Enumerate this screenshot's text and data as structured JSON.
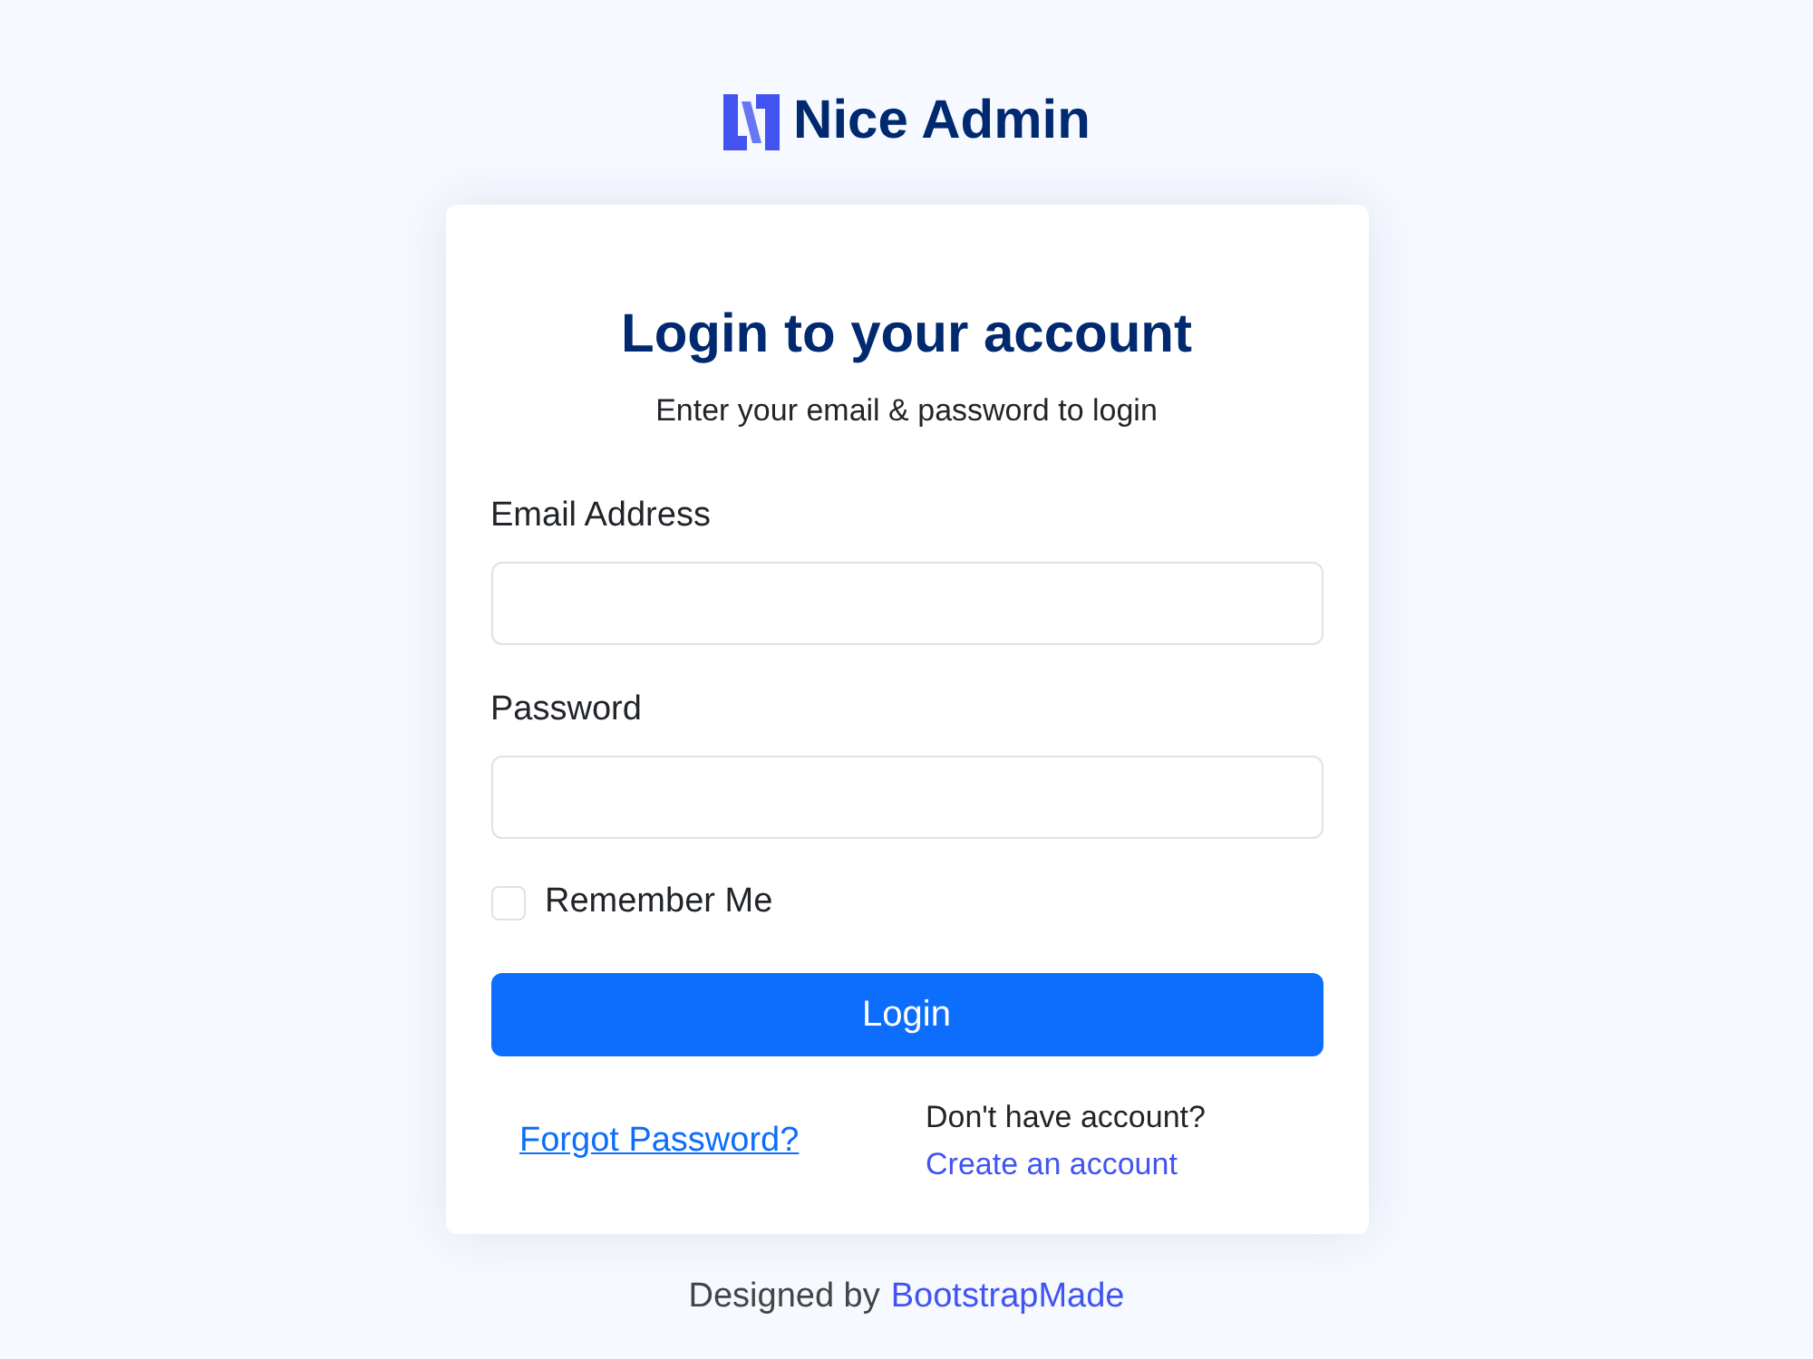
{
  "logo": {
    "text": "Nice Admin"
  },
  "card": {
    "title": "Login to your account",
    "subtitle": "Enter your email & password to login",
    "fields": [
      {
        "label": "Email Address"
      },
      {
        "label": "Password"
      }
    ],
    "remember": {
      "label": "Remember Me",
      "checked": false
    },
    "login_button": "Login",
    "forgot_link": "Forgot Password?",
    "signup": {
      "prompt": "Don't have account?",
      "link": "Create an account"
    }
  },
  "footer": {
    "text": "Designed by",
    "link": "BootstrapMade"
  }
}
